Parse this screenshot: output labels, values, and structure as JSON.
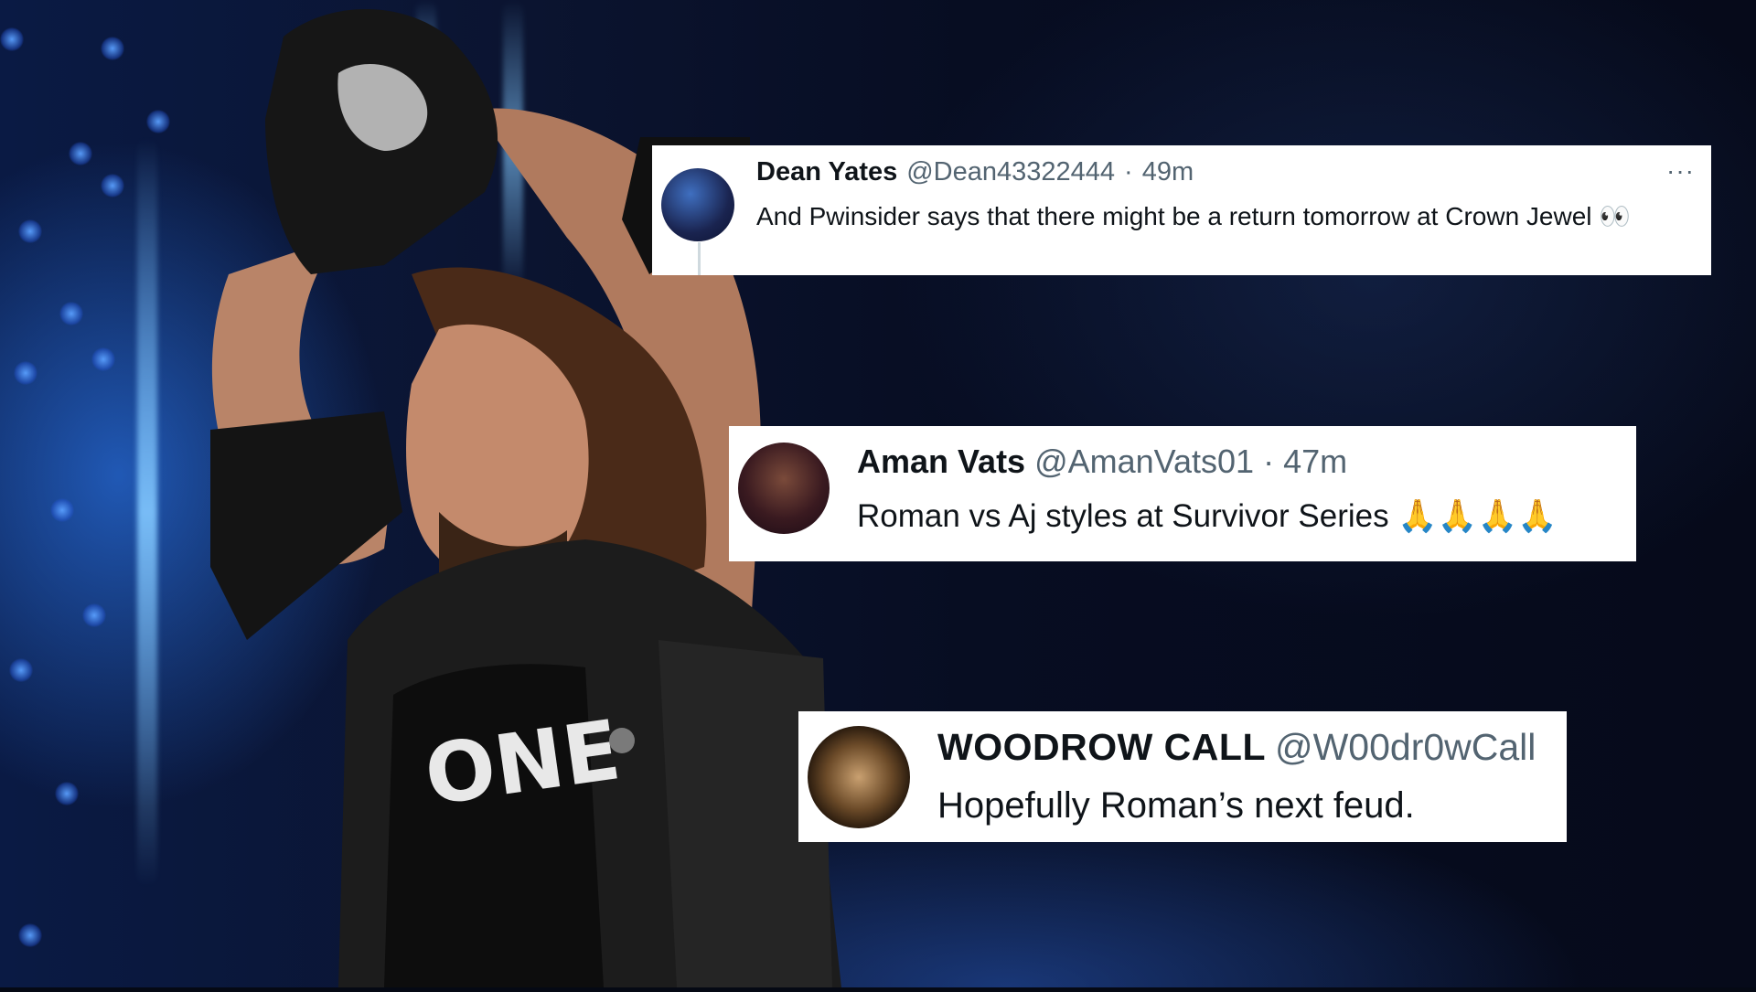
{
  "tweets": [
    {
      "name": "Dean Yates",
      "handle": "@Dean43322444",
      "separator": "·",
      "time": "49m",
      "text": "And Pwinsider says that there might be a return tomorrow at Crown Jewel 👀",
      "more": "···"
    },
    {
      "name": "Aman Vats",
      "handle": "@AmanVats01",
      "separator": "·",
      "time": "47m",
      "text": "Roman vs Aj styles at Survivor Series 🙏🙏🙏🙏"
    },
    {
      "name": "WOODROW CALL",
      "handle": "@W00dr0wCall",
      "text": "Hopefully Roman’s next feud."
    }
  ],
  "icons": {
    "tweet1_avatar": "avatar-image",
    "tweet2_avatar": "avatar-image",
    "tweet3_avatar": "avatar-image",
    "more": "more-options-icon"
  },
  "colors": {
    "card_background": "#ffffff",
    "name_text": "#0f1419",
    "secondary_text": "#536471",
    "background_blue": "#0a1a44"
  }
}
